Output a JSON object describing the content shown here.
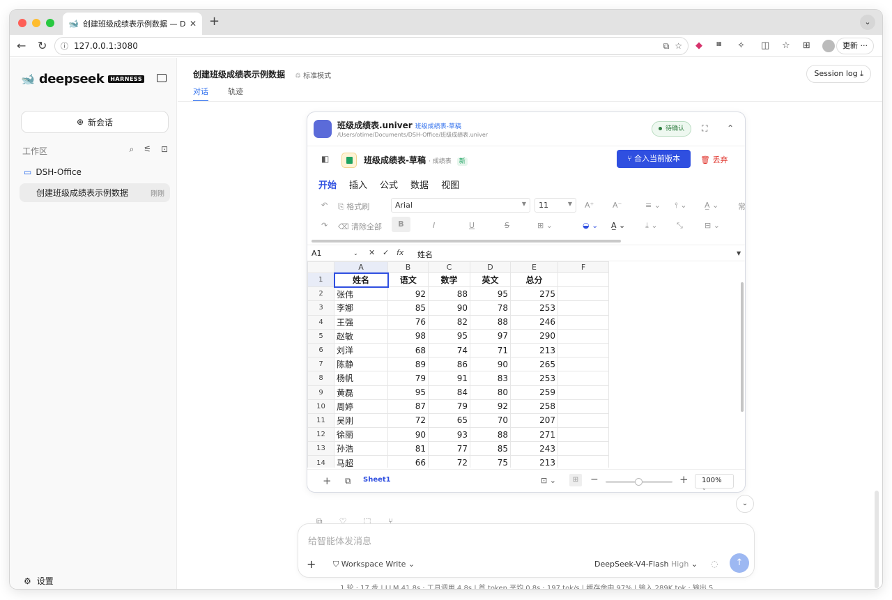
{
  "browser": {
    "tab_title": "创建班级成绩表示例数据 — DeepSeek",
    "url": "127.0.0.1:3080",
    "update_label": "更新"
  },
  "sidebar": {
    "brand": "deepseek",
    "brand_badge": "HARNESS",
    "new_chat": "新会话",
    "workspace_label": "工作区",
    "folder": "DSH-Office",
    "conversation": {
      "title": "创建班级成绩表示例数据",
      "time": "刚刚"
    },
    "settings": "设置"
  },
  "header": {
    "title": "创建班级成绩表示例数据",
    "mode": "标准模式",
    "tabs": [
      "对话",
      "轨迹"
    ],
    "session_log": "Session log"
  },
  "card": {
    "title": "班级成绩表.univer",
    "tag": "班级成绩表-草稿",
    "path": "/Users/otime/Documents/DSH-Office/班级成绩表.univer",
    "status": "待确认",
    "doc_name": "班级成绩表-草稿",
    "doc_sub": "· 成绩表",
    "doc_new": "新",
    "merge_label": "合入当前版本",
    "discard_label": "丢弃",
    "menu": [
      "开始",
      "插入",
      "公式",
      "数据",
      "视图"
    ],
    "ribbon": {
      "format_painter": "格式刷",
      "clear_all": "清除全部",
      "font": "Arial",
      "font_size": "11",
      "overflow_text": "常"
    },
    "formula_bar": {
      "cell_ref": "A1",
      "fx": "fx",
      "value": "姓名"
    },
    "columns": [
      "A",
      "B",
      "C",
      "D",
      "E",
      "F"
    ],
    "headers": [
      "姓名",
      "语文",
      "数学",
      "英文",
      "总分"
    ],
    "rows": [
      [
        "张伟",
        "92",
        "88",
        "95",
        "275"
      ],
      [
        "李娜",
        "85",
        "90",
        "78",
        "253"
      ],
      [
        "王强",
        "76",
        "82",
        "88",
        "246"
      ],
      [
        "赵敏",
        "98",
        "95",
        "97",
        "290"
      ],
      [
        "刘洋",
        "68",
        "74",
        "71",
        "213"
      ],
      [
        "陈静",
        "89",
        "86",
        "90",
        "265"
      ],
      [
        "杨帆",
        "79",
        "91",
        "83",
        "253"
      ],
      [
        "黄磊",
        "95",
        "84",
        "80",
        "259"
      ],
      [
        "周婷",
        "87",
        "79",
        "92",
        "258"
      ],
      [
        "吴刚",
        "72",
        "65",
        "70",
        "207"
      ],
      [
        "徐丽",
        "90",
        "93",
        "88",
        "271"
      ],
      [
        "孙浩",
        "81",
        "77",
        "85",
        "243"
      ],
      [
        "马超",
        "66",
        "72",
        "75",
        "213"
      ]
    ],
    "row_numbers": [
      "1",
      "2",
      "3",
      "4",
      "5",
      "6",
      "7",
      "8",
      "9",
      "10",
      "11",
      "12",
      "13",
      "14"
    ],
    "sheet_name": "Sheet1",
    "zoom": "100%"
  },
  "composer": {
    "placeholder": "给智能体发消息",
    "workspace_write": "Workspace Write",
    "model": "DeepSeek-V4-Flash",
    "level": "High"
  },
  "stats": "1 轮 · 17 步 | LLM 41.8s · 工具调用 4.8s | 首 token 平均 0.8s · 197 tok/s | 缓存命中 97% | 输入 289K tok · 输出 5...",
  "colors": {
    "accent": "#2f4fe0",
    "link": "#2f6fed",
    "danger": "#e0342c",
    "ok": "#2e7d3f"
  }
}
